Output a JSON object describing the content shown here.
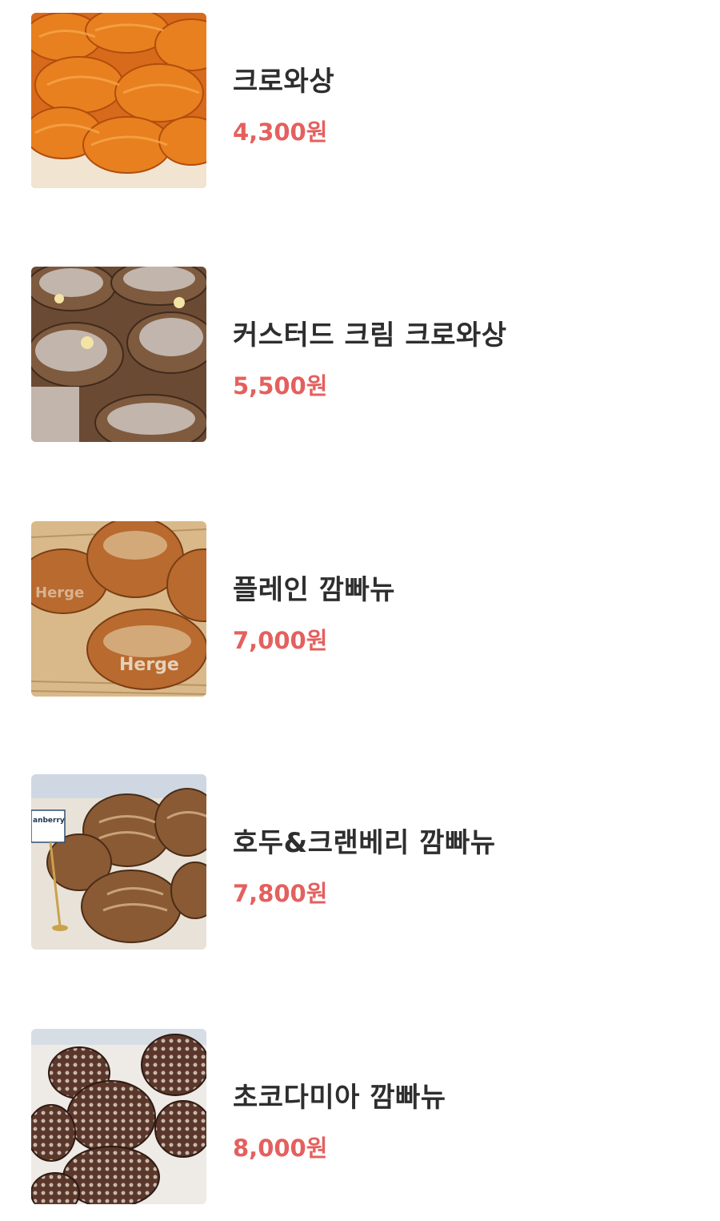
{
  "menu": {
    "items": [
      {
        "name": "크로와상",
        "price": "4,300원",
        "image_icon": "croissant-photo"
      },
      {
        "name": "커스터드 크림 크로와상",
        "price": "5,500원",
        "image_icon": "custard-croissant-photo"
      },
      {
        "name": "플레인 깜빠뉴",
        "price": "7,000원",
        "image_icon": "plain-campagne-photo"
      },
      {
        "name": "호두&크랜베리 깜빠뉴",
        "price": "7,800원",
        "image_icon": "walnut-cranberry-campagne-photo"
      },
      {
        "name": "초코다미아 깜빠뉴",
        "price": "8,000원",
        "image_icon": "chocodamia-campagne-photo"
      }
    ]
  },
  "colors": {
    "price": "#e4605e",
    "name": "#2e2e2e",
    "background": "#ffffff"
  }
}
